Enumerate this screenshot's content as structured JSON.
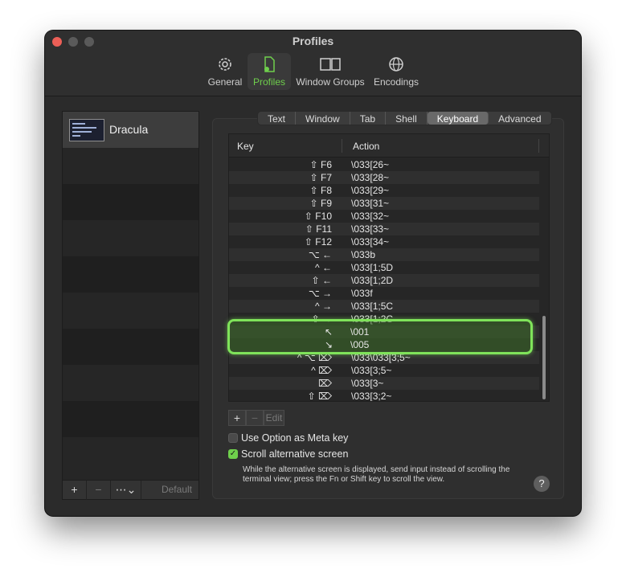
{
  "window": {
    "title": "Profiles"
  },
  "toolbar": {
    "items": [
      {
        "label": "General",
        "icon": "gear-icon"
      },
      {
        "label": "Profiles",
        "icon": "profile-doc-icon"
      },
      {
        "label": "Window Groups",
        "icon": "window-groups-icon"
      },
      {
        "label": "Encodings",
        "icon": "globe-icon"
      }
    ],
    "active": "Profiles",
    "accent_color": "#6fcf4c"
  },
  "sidebar": {
    "profiles": [
      {
        "name": "Dracula"
      }
    ],
    "footer": {
      "add": "+",
      "remove": "−",
      "more": "⋯⌄",
      "default_label": "Default"
    }
  },
  "tabs": [
    {
      "label": "Text"
    },
    {
      "label": "Window"
    },
    {
      "label": "Tab"
    },
    {
      "label": "Shell"
    },
    {
      "label": "Keyboard"
    },
    {
      "label": "Advanced"
    }
  ],
  "selected_tab": "Keyboard",
  "table": {
    "headers": {
      "key": "Key",
      "action": "Action"
    },
    "rows": [
      {
        "key": "⇧ F6",
        "action": "\\033[26~"
      },
      {
        "key": "⇧ F7",
        "action": "\\033[28~"
      },
      {
        "key": "⇧ F8",
        "action": "\\033[29~"
      },
      {
        "key": "⇧ F9",
        "action": "\\033[31~"
      },
      {
        "key": "⇧ F10",
        "action": "\\033[32~"
      },
      {
        "key": "⇧ F11",
        "action": "\\033[33~"
      },
      {
        "key": "⇧ F12",
        "action": "\\033[34~"
      },
      {
        "key": "⌥ ←",
        "action": "\\033b"
      },
      {
        "key": "^ ←",
        "action": "\\033[1;5D"
      },
      {
        "key": "⇧ ←",
        "action": "\\033[1;2D"
      },
      {
        "key": "⌥ →",
        "action": "\\033f"
      },
      {
        "key": "^ →",
        "action": "\\033[1;5C"
      },
      {
        "key": "⇧ →",
        "action": "\\033[1;2C"
      },
      {
        "key": "↖",
        "action": "\\001"
      },
      {
        "key": "↘",
        "action": "\\005"
      },
      {
        "key": "^ ⌥ ⌦",
        "action": "\\033\\033[3;5~"
      },
      {
        "key": "^ ⌦",
        "action": "\\033[3;5~"
      },
      {
        "key": "⌦",
        "action": "\\033[3~"
      },
      {
        "key": "⇧ ⌦",
        "action": "\\033[3;2~"
      }
    ],
    "highlighted": [
      {
        "key": "↖",
        "action": "\\001"
      },
      {
        "key": "↘",
        "action": "\\005"
      }
    ],
    "highlight_color": "#7fe35a"
  },
  "table_controls": {
    "add": "+",
    "remove": "−",
    "edit": "Edit"
  },
  "options": {
    "meta_key": {
      "label": "Use Option as Meta key",
      "checked": false
    },
    "scroll_alt": {
      "label": "Scroll alternative screen",
      "checked": true
    },
    "help_text": "While the alternative screen is displayed, send input instead of scrolling the terminal view; press the Fn or Shift key to scroll the view."
  },
  "help_button": "?"
}
